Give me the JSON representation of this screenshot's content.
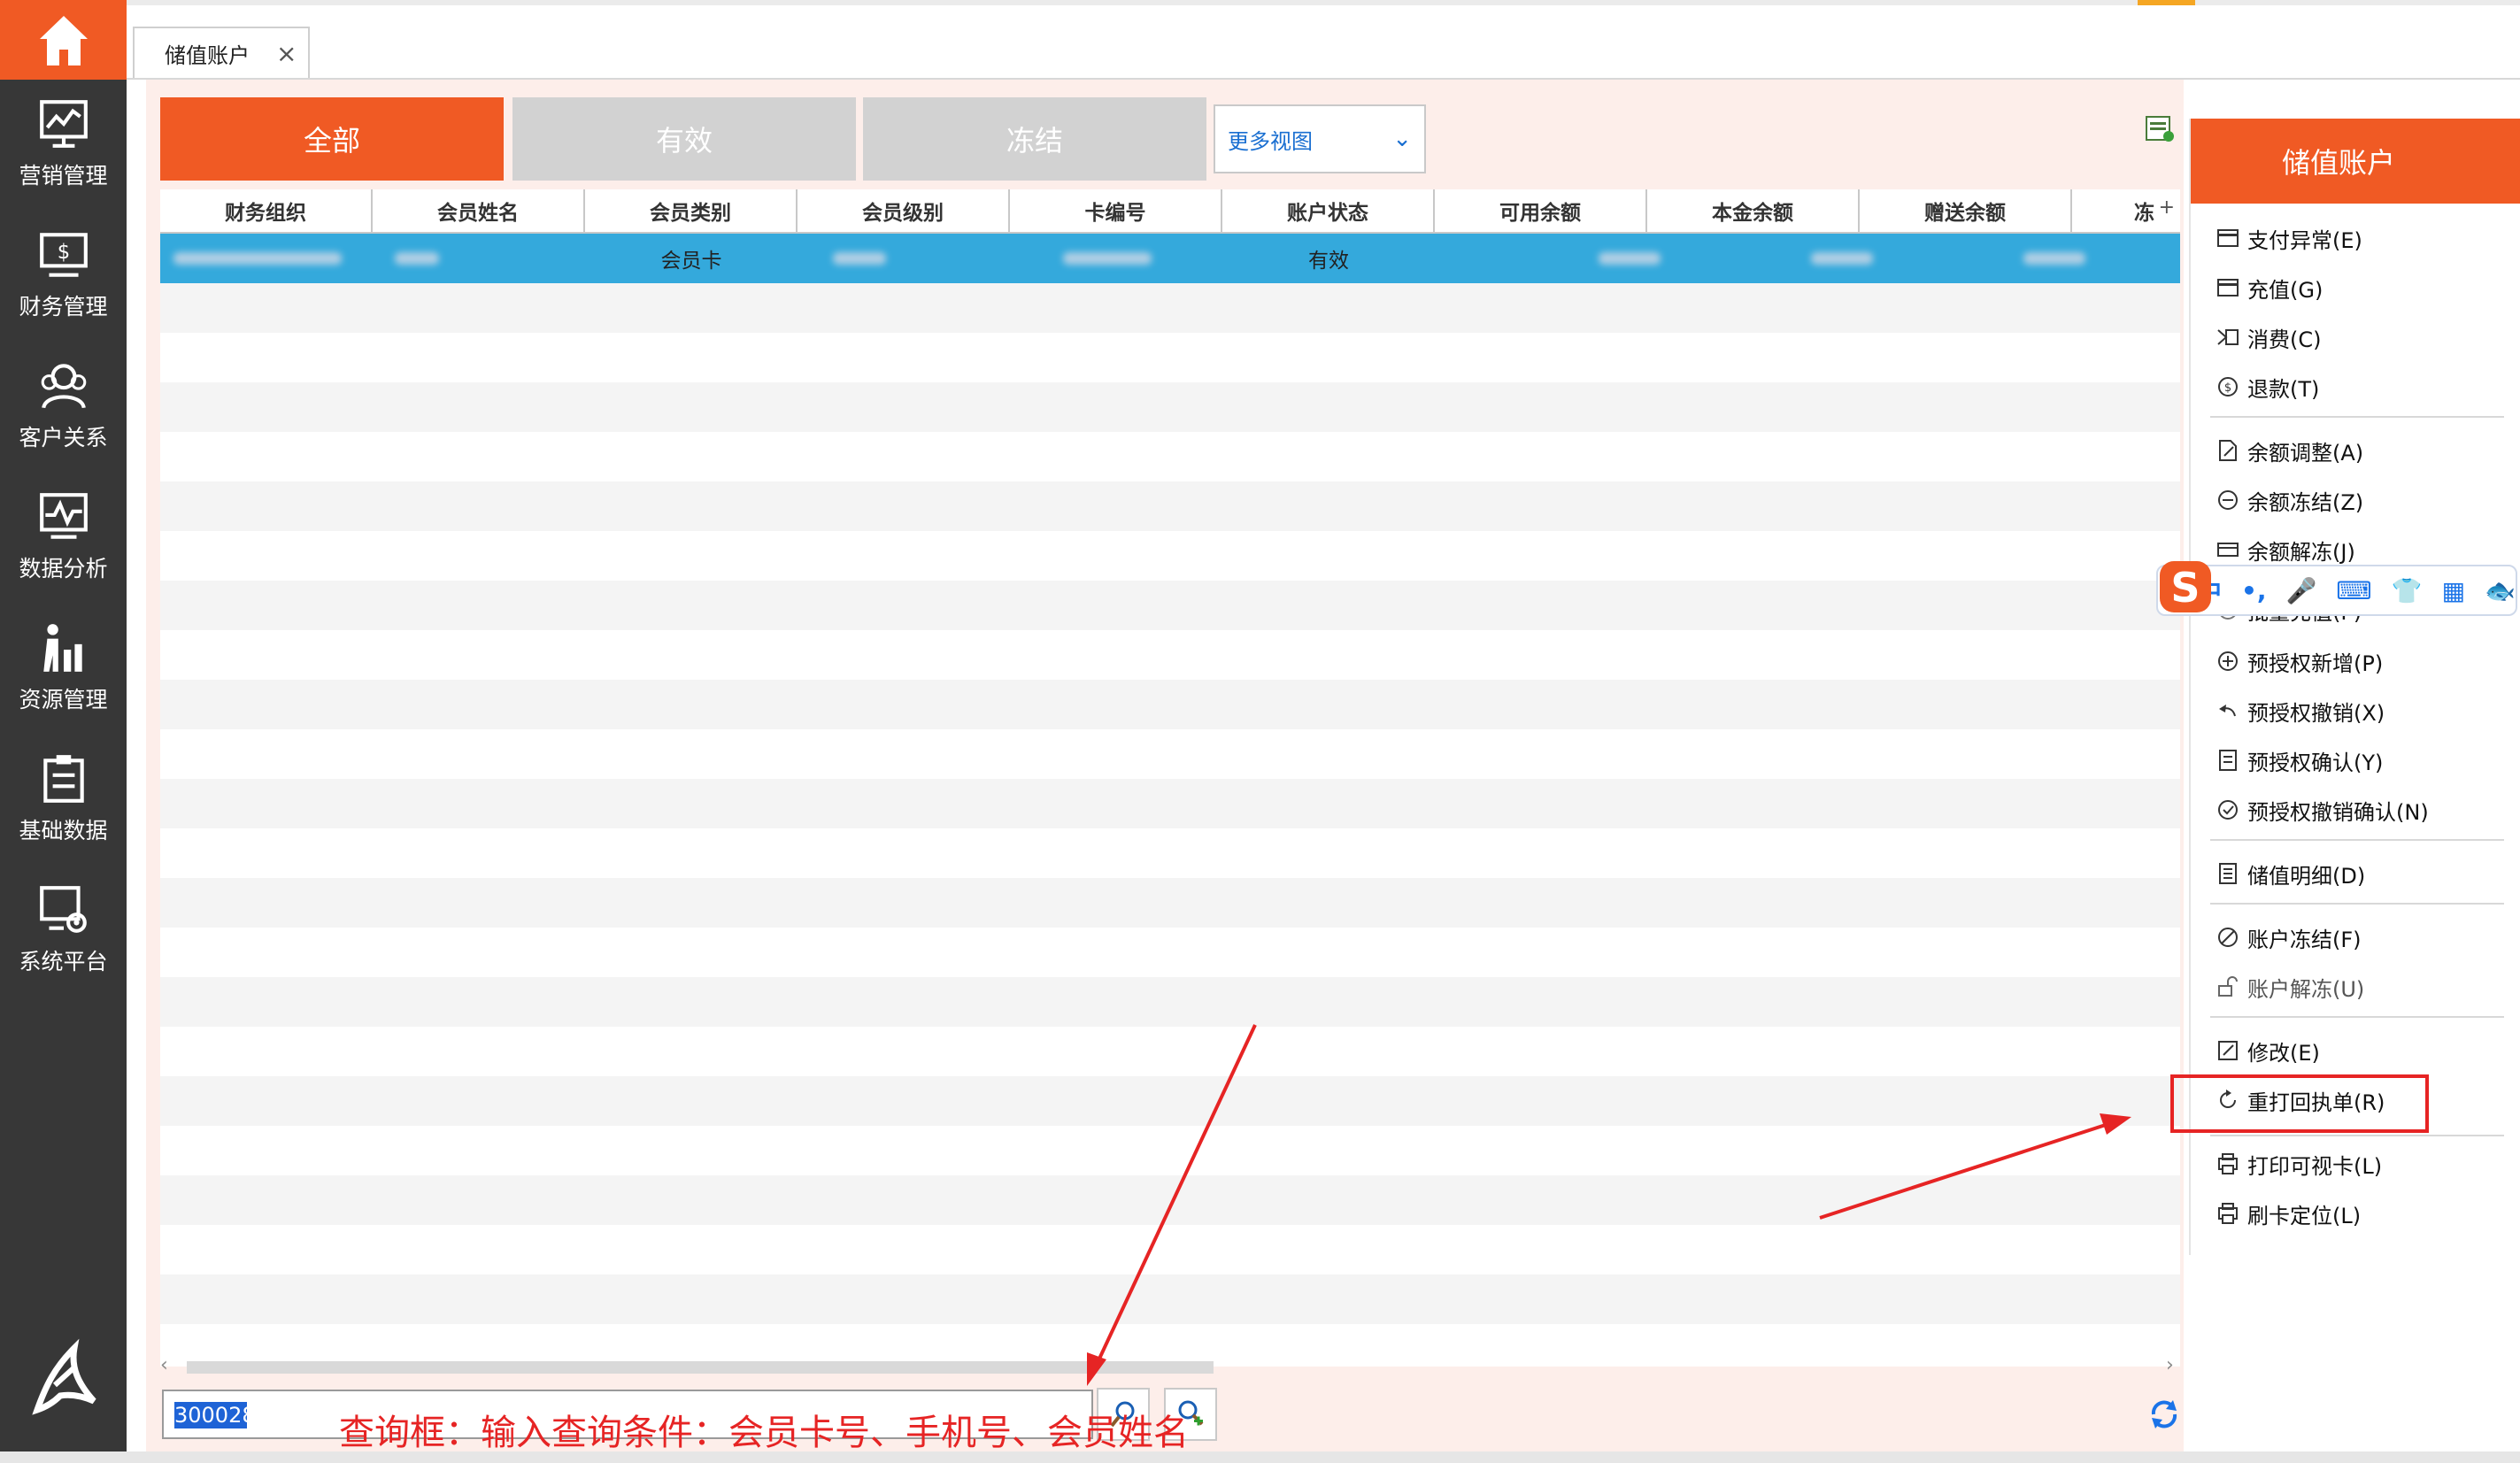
{
  "nav": {
    "home_icon": "home-icon",
    "items": [
      {
        "label": "营销管理",
        "icon": "marketing-chart-icon"
      },
      {
        "label": "财务管理",
        "icon": "finance-monitor-icon"
      },
      {
        "label": "客户关系",
        "icon": "customers-icon"
      },
      {
        "label": "数据分析",
        "icon": "analytics-icon"
      },
      {
        "label": "资源管理",
        "icon": "resource-icon"
      },
      {
        "label": "基础数据",
        "icon": "clipboard-icon"
      },
      {
        "label": "系统平台",
        "icon": "system-gear-icon"
      }
    ]
  },
  "tabs": [
    {
      "label": "储值账户",
      "close": "×"
    }
  ],
  "filters": {
    "all": "全部",
    "valid": "有效",
    "frozen": "冻结",
    "more_views": "更多视图"
  },
  "grid": {
    "columns": [
      "财务组织",
      "会员姓名",
      "会员类别",
      "会员级别",
      "卡编号",
      "账户状态",
      "可用余额",
      "本金余额",
      "赠送余额",
      "冻"
    ],
    "rows": [
      {
        "会员类别": "会员卡",
        "账户状态": "有效"
      }
    ]
  },
  "search": {
    "value": "300028",
    "annotation": "查询框：输入查询条件：会员卡号、手机号、会员姓名"
  },
  "panel": {
    "title": "储值账户",
    "actions": [
      {
        "label": "支付异常(E)",
        "icon": "card-icon"
      },
      {
        "label": "充值(G)",
        "icon": "card-icon"
      },
      {
        "label": "消费(C)",
        "icon": "consume-icon"
      },
      {
        "label": "退款(T)",
        "icon": "refund-icon"
      },
      {
        "label": "余额调整(A)",
        "icon": "edit-doc-icon"
      },
      {
        "label": "余额冻结(Z)",
        "icon": "minus-circle-icon"
      },
      {
        "label": "余额解冻(J)",
        "icon": "unfreeze-icon"
      },
      {
        "label": "批量充值(P)",
        "icon": "batch-icon"
      },
      {
        "label": "预授权新增(P)",
        "icon": "plus-circle-icon"
      },
      {
        "label": "预授权撤销(X)",
        "icon": "undo-icon"
      },
      {
        "label": "预授权确认(Y)",
        "icon": "doc-icon"
      },
      {
        "label": "预授权撤销确认(N)",
        "icon": "check-circle-icon"
      },
      {
        "label": "储值明细(D)",
        "icon": "list-doc-icon"
      },
      {
        "label": "账户冻结(F)",
        "icon": "ban-icon"
      },
      {
        "label": "账户解冻(U)",
        "icon": "unlock-icon"
      },
      {
        "label": "修改(E)",
        "icon": "pencil-icon"
      },
      {
        "label": "重打回执单(R)",
        "icon": "reprint-icon"
      },
      {
        "label": "打印可视卡(L)",
        "icon": "printer-icon"
      },
      {
        "label": "刷卡定位(L)",
        "icon": "printer-icon"
      }
    ]
  },
  "ime": {
    "items": [
      "中",
      "•,",
      "🎤",
      "⌨",
      "👕",
      "▦",
      "🐟"
    ]
  },
  "colors": {
    "accent": "#f05a24",
    "nav_bg": "#373737",
    "selected_row": "#34a9dc",
    "annotation": "#e62424"
  }
}
